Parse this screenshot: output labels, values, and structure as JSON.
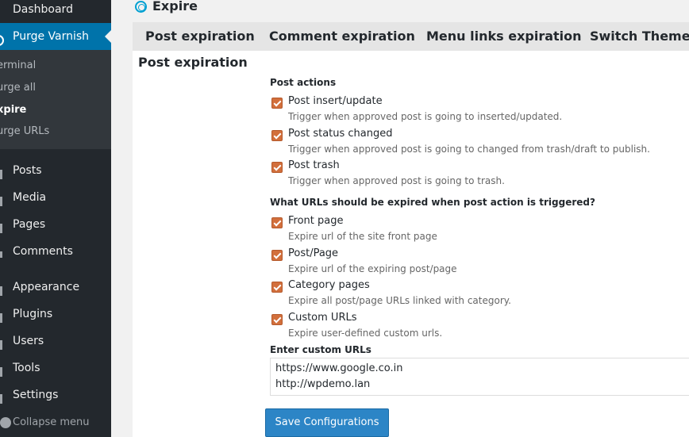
{
  "sidebar": {
    "items": [
      {
        "label": "Dashboard",
        "icon": "dashboard-icon"
      },
      {
        "label": "Purge Varnish",
        "icon": "purge-varnish-icon"
      },
      {
        "label": "Posts",
        "icon": "pin-icon"
      },
      {
        "label": "Media",
        "icon": "media-icon"
      },
      {
        "label": "Pages",
        "icon": "pages-icon"
      },
      {
        "label": "Comments",
        "icon": "comments-icon"
      },
      {
        "label": "Appearance",
        "icon": "paintbrush-icon"
      },
      {
        "label": "Plugins",
        "icon": "plugin-icon"
      },
      {
        "label": "Users",
        "icon": "users-icon"
      },
      {
        "label": "Tools",
        "icon": "tools-icon"
      },
      {
        "label": "Settings",
        "icon": "settings-icon"
      }
    ],
    "submenu": [
      {
        "label": "erminal"
      },
      {
        "label": "urge all"
      },
      {
        "label": "xpire"
      },
      {
        "label": "urge URLs"
      }
    ],
    "collapse_label": "Collapse menu"
  },
  "header": {
    "title": "Expire"
  },
  "tabs": [
    {
      "label": "Post expiration"
    },
    {
      "label": "Comment expiration"
    },
    {
      "label": "Menu links expiration"
    },
    {
      "label": "Switch Theme"
    }
  ],
  "section_title": "Post expiration",
  "post_actions": {
    "title": "Post actions",
    "options": [
      {
        "label": "Post insert/update",
        "desc": "Trigger when approved post is going to inserted/updated."
      },
      {
        "label": "Post status changed",
        "desc": "Trigger when approved post is going to changed from trash/draft to publish."
      },
      {
        "label": "Post trash",
        "desc": "Trigger when approved post is going to trash."
      }
    ]
  },
  "urls_expire": {
    "title": "What URLs should be expired when post action is triggered?",
    "options": [
      {
        "label": "Front page",
        "desc": "Expire url of the site front page"
      },
      {
        "label": "Post/Page",
        "desc": "Expire url of the expiring post/page"
      },
      {
        "label": "Category pages",
        "desc": "Expire all post/page URLs linked with category."
      },
      {
        "label": "Custom URLs",
        "desc": "Expire user-defined custom urls."
      }
    ]
  },
  "custom_urls": {
    "label": "Enter custom URLs",
    "lines": [
      "https://www.google.co.in",
      "http://wpdemo.lan"
    ]
  },
  "save_label": "Save Configurations",
  "colors": {
    "sidebar": "#23282d",
    "active": "#0073aa",
    "checkbox": "#d26f3c",
    "button": "#2c85c6"
  }
}
